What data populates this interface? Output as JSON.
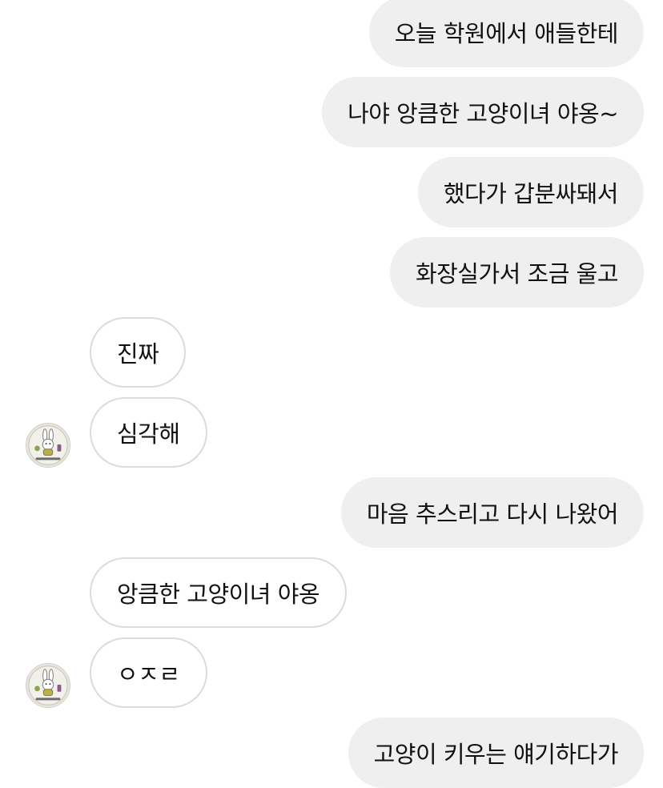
{
  "messages": [
    {
      "side": "sent",
      "text": "오늘 학원에서 애들한테"
    },
    {
      "side": "sent",
      "text": "나야 앙큼한 고양이녀 야옹~"
    },
    {
      "side": "sent",
      "text": "했다가 갑분싸돼서"
    },
    {
      "side": "sent",
      "text": "화장실가서 조금 울고"
    },
    {
      "side": "received",
      "text": "진짜"
    },
    {
      "side": "received",
      "text": "심각해"
    },
    {
      "side": "sent",
      "text": "마음 추스리고 다시 나왔어"
    },
    {
      "side": "received",
      "text": "앙큼한 고양이녀 야옹"
    },
    {
      "side": "received",
      "text": "ㅇㅈㄹ"
    },
    {
      "side": "sent",
      "text": "고양이 키우는 얘기하다가"
    }
  ],
  "avatar": {
    "icon": "bunny-avatar-icon"
  },
  "colors": {
    "sent_bubble": "#efefef",
    "received_bubble": "#ffffff",
    "received_border": "#dbdbdb",
    "text": "#111111"
  }
}
